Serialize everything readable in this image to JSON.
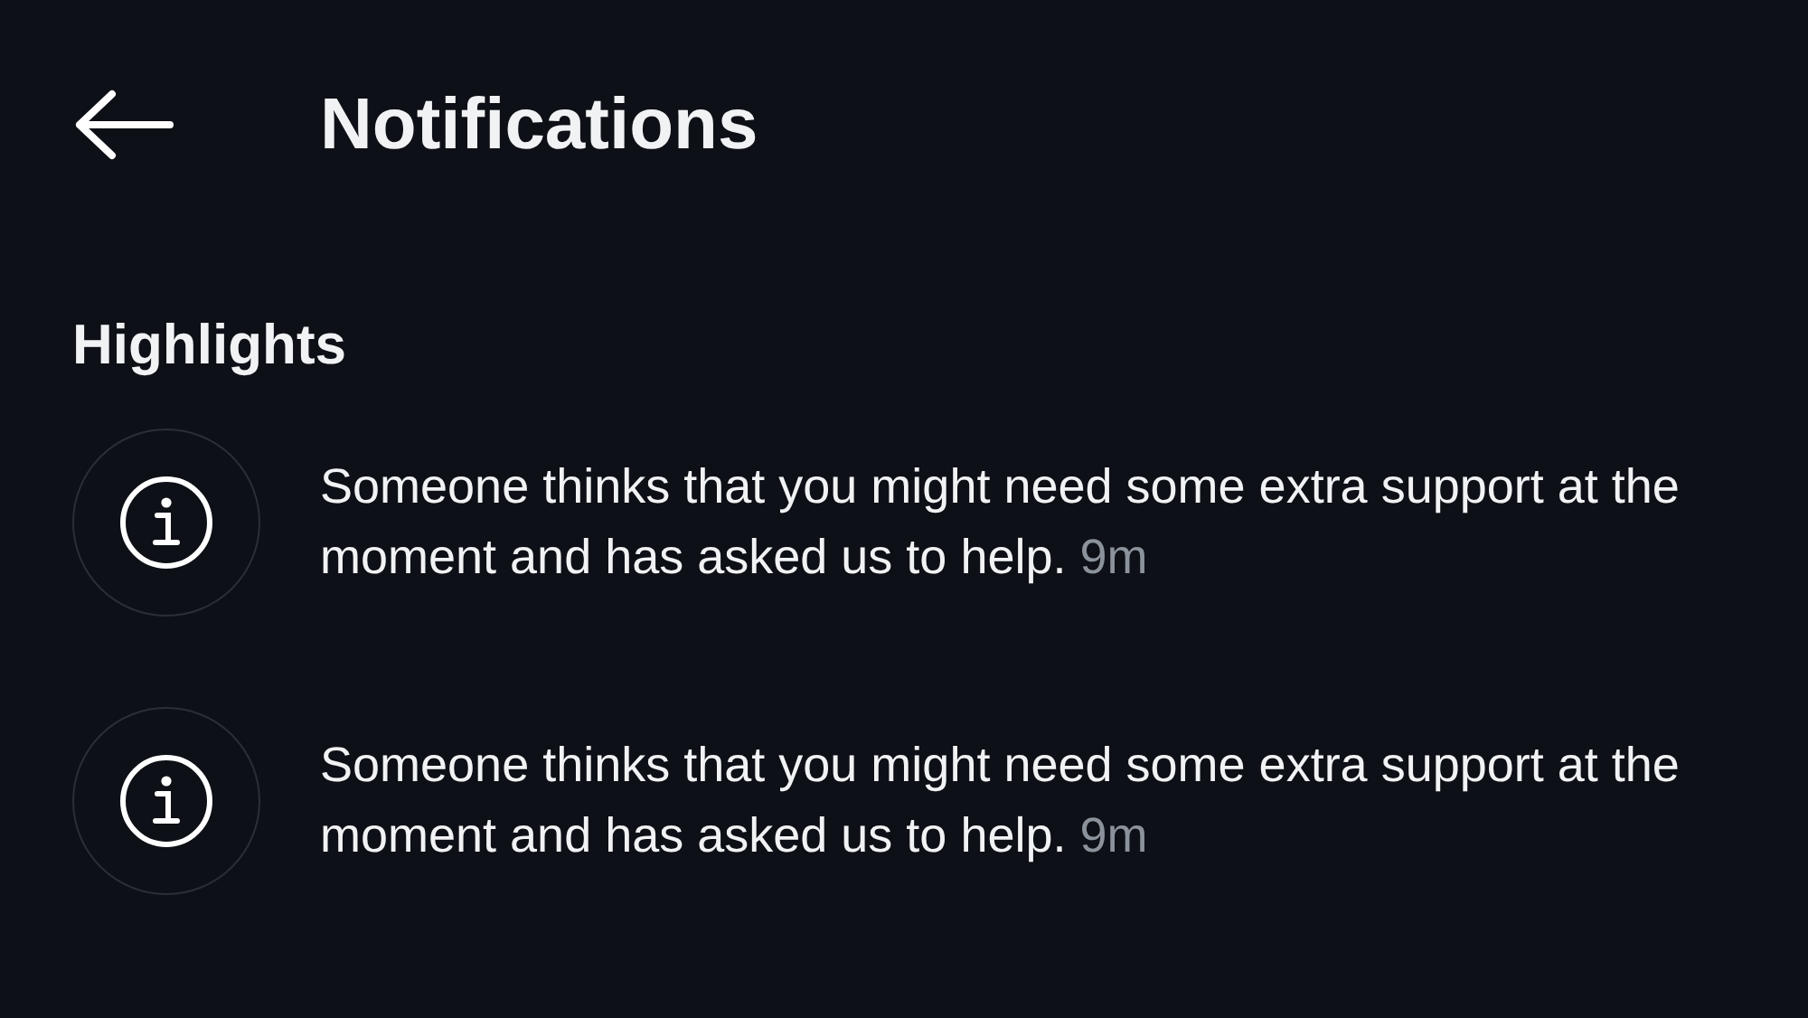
{
  "header": {
    "title": "Notifications"
  },
  "section": {
    "title": "Highlights"
  },
  "notifications": [
    {
      "kind": "info",
      "message": "Someone thinks that you might need some extra support at the moment and has asked us to help.",
      "time": "9m"
    },
    {
      "kind": "info",
      "message": "Someone thinks that you might need some extra support at the moment and has asked us to help.",
      "time": "9m"
    }
  ]
}
